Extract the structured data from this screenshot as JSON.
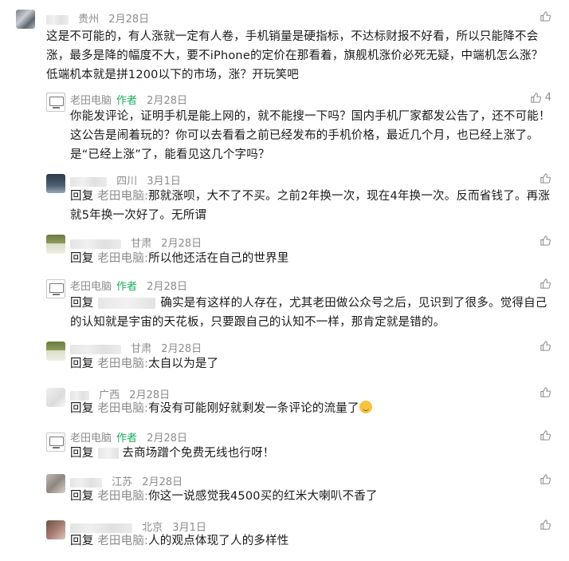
{
  "comments": [
    {
      "location": "贵州",
      "date": "2月28日",
      "text": "这是不可能的，有人涨就一定有人卷，手机销量是硬指标，不达标财报不好看，所以只能降不会涨，最多是降的幅度不大，要不iPhone的定价在那看着，旗舰机涨价必死无疑，中端机怎么涨？低端机本就是拼1200以下的市场，涨？开玩笑吧",
      "like_count": ""
    },
    {
      "name": "老田电脑",
      "author_tag": "作者",
      "date": "2月28日",
      "text": "你能发评论，证明手机是能上网的，就不能搜一下吗？国内手机厂家都发公告了，还不可能！这公告是闹着玩的？你可以去看看之前已经发布的手机价格，最近几个月，也已经上涨了。是“已经上涨”了，能看见这几个字吗？",
      "like_count": "4"
    },
    {
      "location": "四川",
      "date": "3月1日",
      "reply_word": "回复",
      "reply_to": "老田电脑:",
      "text": "那就涨呗，大不了不买。之前2年换一次，现在4年换一次。反而省钱了。再涨就5年换一次好了。无所谓"
    },
    {
      "location": "甘肃",
      "date": "2月28日",
      "reply_word": "回复",
      "reply_to": "老田电脑:",
      "text": "所以他还活在自己的世界里"
    },
    {
      "name": "老田电脑",
      "author_tag": "作者",
      "date": "2月28日",
      "reply_word": "回复",
      "text": "确实是有这样的人存在，尤其老田做公众号之后，见识到了很多。觉得自己的认知就是宇宙的天花板，只要跟自己的认知不一样，那肯定就是错的。"
    },
    {
      "location": "甘肃",
      "date": "2月28日",
      "reply_word": "回复",
      "reply_to": "老田电脑:",
      "text": "太自以为是了"
    },
    {
      "location": "广西",
      "date": "2月28日",
      "reply_word": "回复",
      "reply_to": "老田电脑:",
      "text": "有没有可能刚好就剩发一条评论的流量了"
    },
    {
      "name": "老田电脑",
      "author_tag": "作者",
      "date": "2月28日",
      "reply_word": "回复",
      "text": "去商场蹭个免费无线也行呀！"
    },
    {
      "location": "江苏",
      "date": "2月28日",
      "reply_word": "回复",
      "reply_to": "老田电脑:",
      "text": "你这一说感觉我4500买的红米大喇叭不香了"
    },
    {
      "location": "北京",
      "date": "3月1日",
      "reply_word": "回复",
      "reply_to": "老田电脑:",
      "text": "人的观点体现了人的多样性"
    }
  ],
  "icons": {
    "like": "thumb-up-icon",
    "author_avatar": "computer-icon",
    "emoji": "thinking-face-emoji"
  }
}
